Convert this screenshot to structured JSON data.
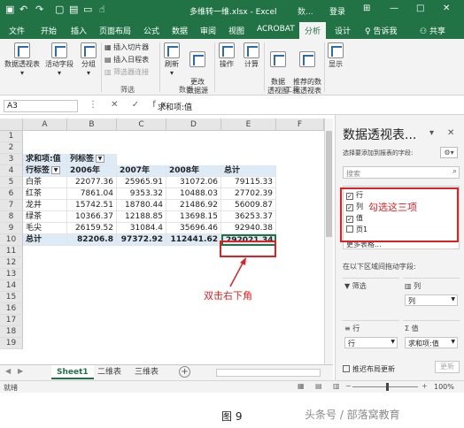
{
  "titlebar": {
    "title": "多维转一维.xlsx - Excel",
    "ctx_tab": "数...",
    "login": "登录",
    "save_icon": "save-icon",
    "undo_icon": "undo-icon",
    "redo_icon": "redo-icon"
  },
  "tabs": [
    "文件",
    "开始",
    "插入",
    "页面布局",
    "公式",
    "数据",
    "审阅",
    "视图",
    "ACROBAT",
    "分析",
    "设计",
    "♀ 告诉我"
  ],
  "active_tab": "分析",
  "share": "共享",
  "ribbon": {
    "buttons": [
      {
        "label": "数据透视表",
        "arrow": "▾"
      },
      {
        "label": "活动字段",
        "arrow": "▾"
      },
      {
        "label": "分组",
        "arrow": "▾"
      }
    ],
    "filter_items": [
      "插入切片器",
      "插入日程表",
      "筛选器连接"
    ],
    "filter_group": "筛选",
    "data_buttons": [
      {
        "label": "刷新",
        "arrow": "▾"
      },
      {
        "label": "更改\n数据源",
        "arrow": "▾"
      }
    ],
    "data_group": "数据",
    "action_button": "操作",
    "calc_button": "计算",
    "tool_buttons": [
      "数据\n透视图",
      "推荐的数\n据透视表"
    ],
    "tool_group": "工具",
    "show_button": "显示"
  },
  "formula_bar": {
    "name_box": "A3",
    "icons": "⋮ ✕ ✓ fx",
    "content": "求和项:值"
  },
  "sheet": {
    "columns": [
      "A",
      "B",
      "C",
      "D",
      "E",
      "F"
    ],
    "rows": [
      "1",
      "2",
      "3",
      "4",
      "5",
      "6",
      "7",
      "8",
      "9",
      "10",
      "11",
      "12",
      "13",
      "14",
      "15",
      "16",
      "17",
      "18",
      "19"
    ],
    "r3": {
      "a": "求和项:值",
      "b": "列标签"
    },
    "r4": {
      "a": "行标签",
      "b": "2006年",
      "c": "2007年",
      "d": "2008年",
      "e": "总计"
    },
    "data": [
      [
        "白茶",
        "22077.36",
        "25965.91",
        "31072.06",
        "79115.33"
      ],
      [
        "红茶",
        "7861.04",
        "9353.32",
        "10488.03",
        "27702.39"
      ],
      [
        "龙井",
        "15742.51",
        "18780.44",
        "21486.92",
        "56009.87"
      ],
      [
        "绿茶",
        "10366.37",
        "12188.85",
        "13698.15",
        "36253.37"
      ],
      [
        "毛尖",
        "26159.52",
        "31084.4",
        "35696.46",
        "92940.38"
      ]
    ],
    "total": [
      "总计",
      "82206.8",
      "97372.92",
      "112441.62",
      "292021.34"
    ]
  },
  "annotation_cell": "双击右下角",
  "annotation_fields": "勾选这三项",
  "sheet_tabs": [
    "Sheet1",
    "二维表",
    "三维表"
  ],
  "pivot_pane": {
    "title": "数据透视表...",
    "subtitle": "选择要添加到报表的字段:",
    "search_placeholder": "搜索",
    "fields": [
      {
        "label": "行",
        "checked": "✓"
      },
      {
        "label": "列",
        "checked": "✓"
      },
      {
        "label": "值",
        "checked": "✓"
      },
      {
        "label": "页1",
        "checked": ""
      }
    ],
    "more_tables": "更多表格...",
    "drag_label": "在以下区域间拖动字段:",
    "area_filter": "筛选",
    "area_columns": "列",
    "area_columns_value": "列",
    "area_rows": "行",
    "area_rows_value": "行",
    "area_values": "Σ 值",
    "area_values_value": "求和项:值",
    "defer": "推迟布局更新",
    "update": "更新"
  },
  "status": {
    "ready": "就绪",
    "zoom": "100%"
  },
  "caption": "图 9",
  "watermark": "头条号 / 部落窝教育"
}
